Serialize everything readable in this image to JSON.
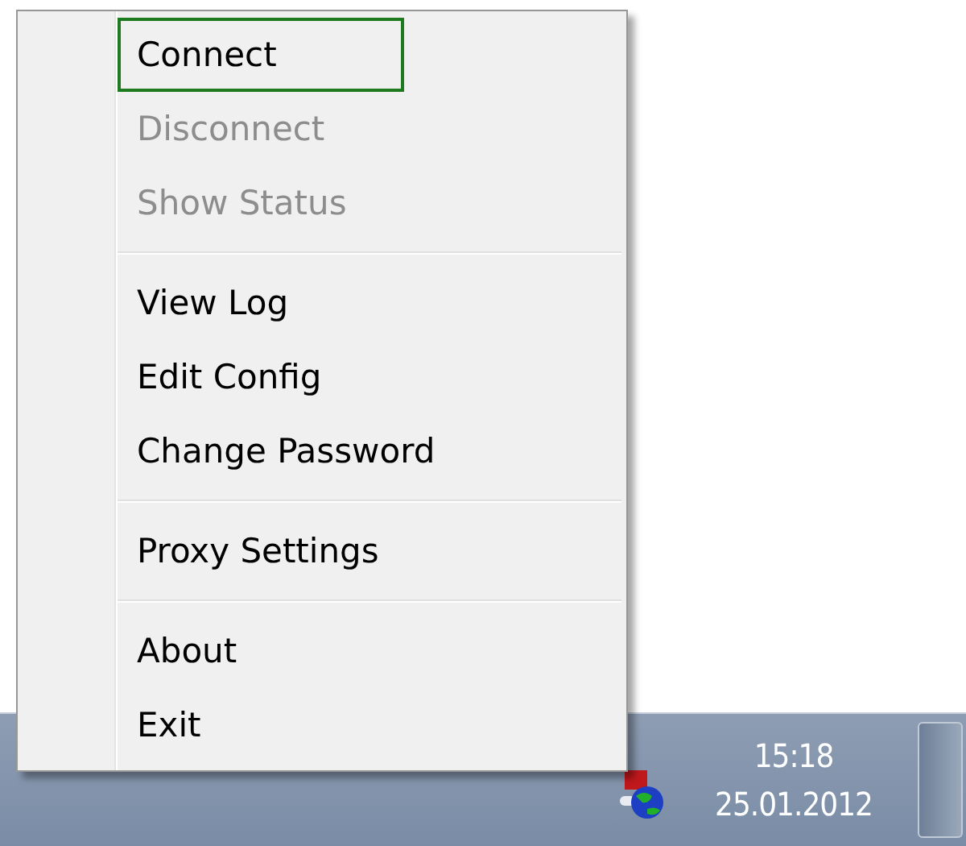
{
  "menu": {
    "items": [
      {
        "kind": "item",
        "label": "Connect",
        "selected": true,
        "disabled": false
      },
      {
        "kind": "item",
        "label": "Disconnect",
        "selected": false,
        "disabled": true
      },
      {
        "kind": "item",
        "label": "Show Status",
        "selected": false,
        "disabled": true
      },
      {
        "kind": "separator"
      },
      {
        "kind": "item",
        "label": "View Log",
        "selected": false,
        "disabled": false
      },
      {
        "kind": "item",
        "label": "Edit Config",
        "selected": false,
        "disabled": false
      },
      {
        "kind": "item",
        "label": "Change Password",
        "selected": false,
        "disabled": false
      },
      {
        "kind": "separator"
      },
      {
        "kind": "item",
        "label": "Proxy Settings",
        "selected": false,
        "disabled": false
      },
      {
        "kind": "separator"
      },
      {
        "kind": "item",
        "label": "About",
        "selected": false,
        "disabled": false
      },
      {
        "kind": "item",
        "label": "Exit",
        "selected": false,
        "disabled": false
      }
    ]
  },
  "taskbar": {
    "time": "15:18",
    "date": "25.01.2012"
  }
}
